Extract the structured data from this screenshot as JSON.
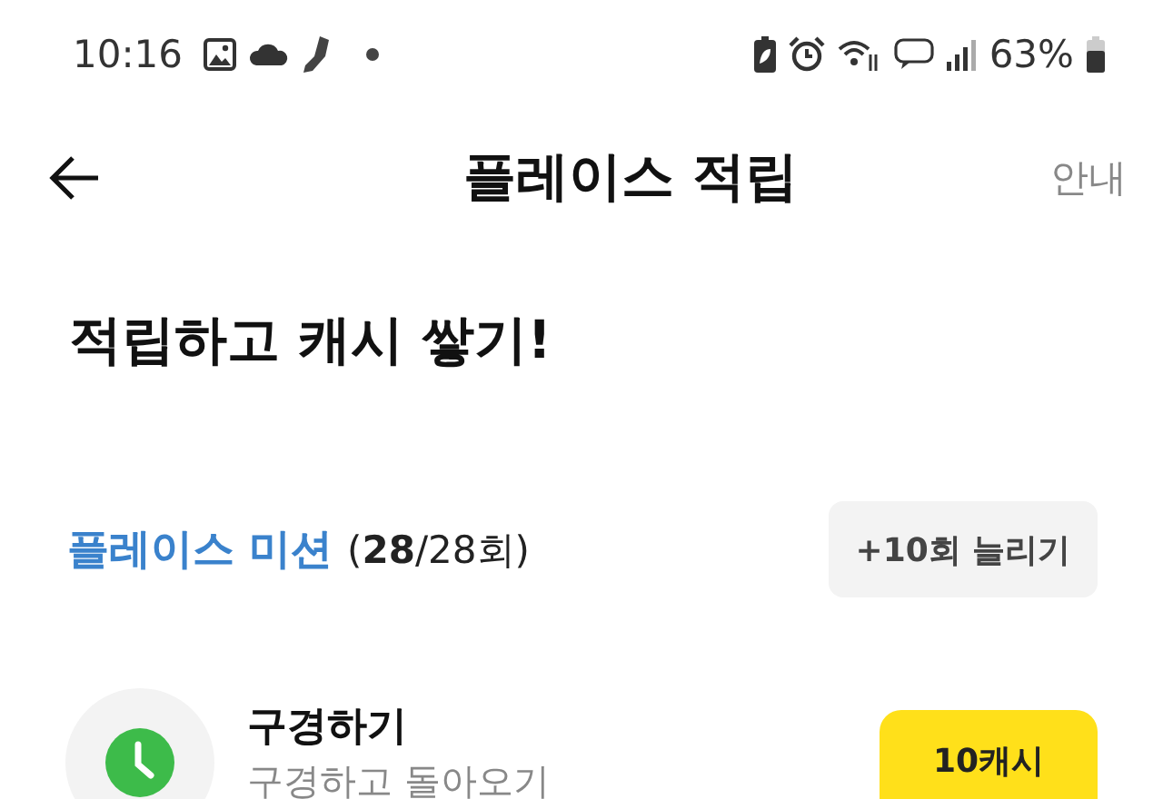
{
  "status_bar": {
    "time": "10:16",
    "battery": "63%"
  },
  "header": {
    "title": "플레이스 적립",
    "action": "안내"
  },
  "heading": "적립하고 캐시 쌓기!",
  "mission": {
    "title": "플레이스 미션",
    "count": "(**28**/28회)",
    "button": "+10회 늘리기"
  },
  "items": [
    {
      "title": "구경하기",
      "subtitle": "구경하고 돌아오기",
      "reward": "10캐시"
    }
  ]
}
